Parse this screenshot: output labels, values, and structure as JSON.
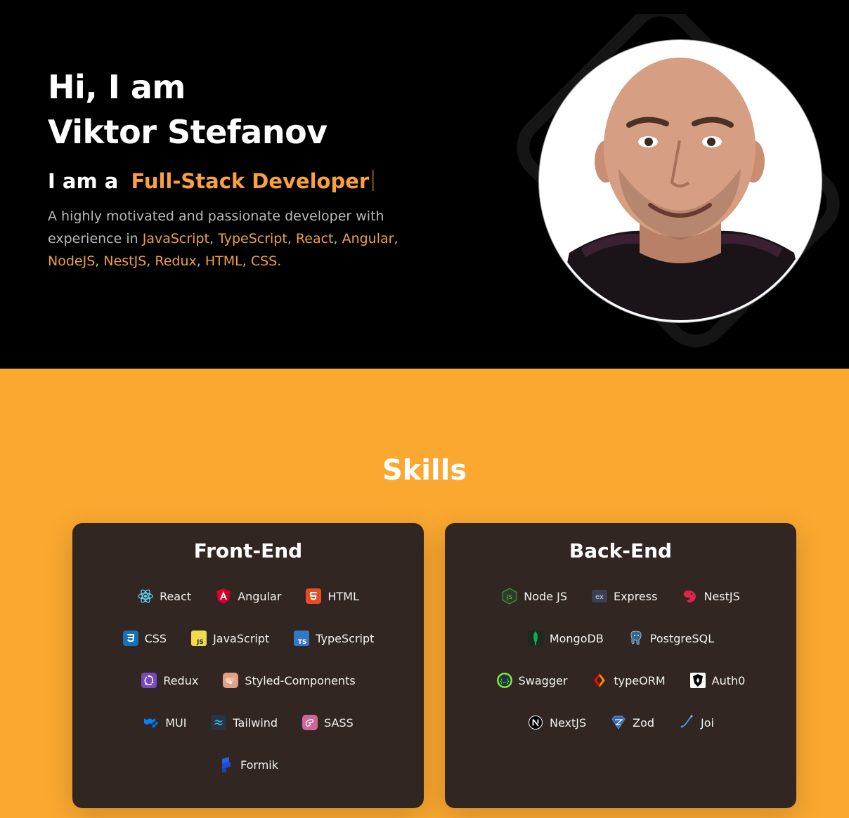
{
  "hero": {
    "greeting": "Hi, I am",
    "name": "Viktor Stefanov",
    "role_prefix": "I am a",
    "role": "Full-Stack Developer",
    "intro_prefix": "A highly motivated and passionate developer with experience in",
    "technologies": [
      "JavaScript",
      "TypeScript",
      "React",
      "Angular",
      "NodeJS",
      "NestJS",
      "Redux",
      "HTML",
      "CSS"
    ],
    "avatar_alt": "Profile photo",
    "accent_color": "#f9a03f"
  },
  "skills": {
    "title": "Skills",
    "background_color": "#fba830",
    "frontend": {
      "title": "Front-End",
      "rows": [
        [
          {
            "label": "React",
            "icon": "react-icon"
          },
          {
            "label": "Angular",
            "icon": "angular-icon"
          },
          {
            "label": "HTML",
            "icon": "html-icon"
          }
        ],
        [
          {
            "label": "CSS",
            "icon": "css-icon"
          },
          {
            "label": "JavaScript",
            "icon": "javascript-icon"
          },
          {
            "label": "TypeScript",
            "icon": "typescript-icon"
          }
        ],
        [
          {
            "label": "Redux",
            "icon": "redux-icon"
          },
          {
            "label": "Styled-Components",
            "icon": "styled-components-icon"
          }
        ],
        [
          {
            "label": "MUI",
            "icon": "mui-icon"
          },
          {
            "label": "Tailwind",
            "icon": "tailwind-icon"
          },
          {
            "label": "SASS",
            "icon": "sass-icon"
          }
        ],
        [
          {
            "label": "Formik",
            "icon": "formik-icon"
          }
        ]
      ]
    },
    "backend": {
      "title": "Back-End",
      "rows": [
        [
          {
            "label": "Node JS",
            "icon": "nodejs-icon"
          },
          {
            "label": "Express",
            "icon": "express-icon"
          },
          {
            "label": "NestJS",
            "icon": "nestjs-icon"
          }
        ],
        [
          {
            "label": "MongoDB",
            "icon": "mongodb-icon"
          },
          {
            "label": "PostgreSQL",
            "icon": "postgresql-icon"
          }
        ],
        [
          {
            "label": "Swagger",
            "icon": "swagger-icon"
          },
          {
            "label": "typeORM",
            "icon": "typeorm-icon"
          },
          {
            "label": "Auth0",
            "icon": "auth0-icon"
          }
        ],
        [
          {
            "label": "NextJS",
            "icon": "nextjs-icon"
          },
          {
            "label": "Zod",
            "icon": "zod-icon"
          },
          {
            "label": "Joi",
            "icon": "joi-icon"
          }
        ]
      ]
    }
  }
}
